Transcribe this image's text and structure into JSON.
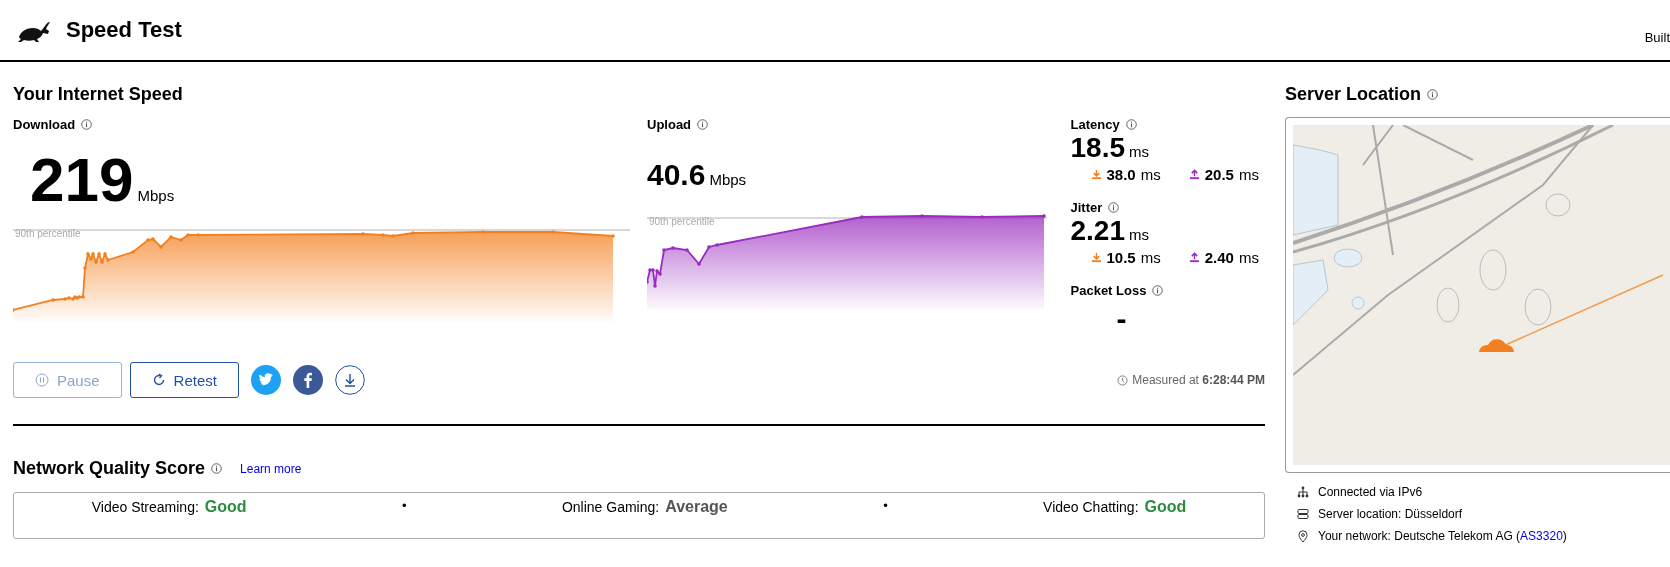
{
  "header": {
    "title": "Speed Test",
    "built_text": "Built"
  },
  "speed": {
    "title": "Your Internet Speed",
    "download": {
      "label": "Download",
      "value": "219",
      "unit": "Mbps",
      "percentile_label": "90th percentile"
    },
    "upload": {
      "label": "Upload",
      "value": "40.6",
      "unit": "Mbps",
      "percentile_label": "90th percentile"
    },
    "latency": {
      "label": "Latency",
      "value": "18.5",
      "unit": "ms",
      "down_value": "38.0",
      "down_unit": "ms",
      "up_value": "20.5",
      "up_unit": "ms"
    },
    "jitter": {
      "label": "Jitter",
      "value": "2.21",
      "unit": "ms",
      "down_value": "10.5",
      "down_unit": "ms",
      "up_value": "2.40",
      "up_unit": "ms"
    },
    "packet_loss": {
      "label": "Packet Loss",
      "value": "-"
    },
    "buttons": [
      {
        "label": "Pause",
        "disabled": true
      },
      {
        "label": "Retest",
        "disabled": false
      }
    ],
    "measured_label": "Measured at",
    "measured_time": "6:28:44 PM"
  },
  "quality": {
    "title": "Network Quality Score",
    "link": "Learn more",
    "scores": [
      {
        "label": "Video Streaming:",
        "rating": "Good",
        "color": "#2e8b3d"
      },
      {
        "label": "Online Gaming:",
        "rating": "Average",
        "color": "#555555"
      },
      {
        "label": "Video Chatting:",
        "rating": "Good",
        "color": "#2e8b3d"
      }
    ],
    "separator": "•"
  },
  "server": {
    "title": "Server Location",
    "details": [
      {
        "kind": "network",
        "text": "Connected via IPv6"
      },
      {
        "kind": "server",
        "text": "Server location: Düsseldorf"
      },
      {
        "kind": "location",
        "text": "Your network: Deutsche Telekom AG (",
        "link": "AS3320",
        "suffix": ")"
      }
    ]
  }
}
